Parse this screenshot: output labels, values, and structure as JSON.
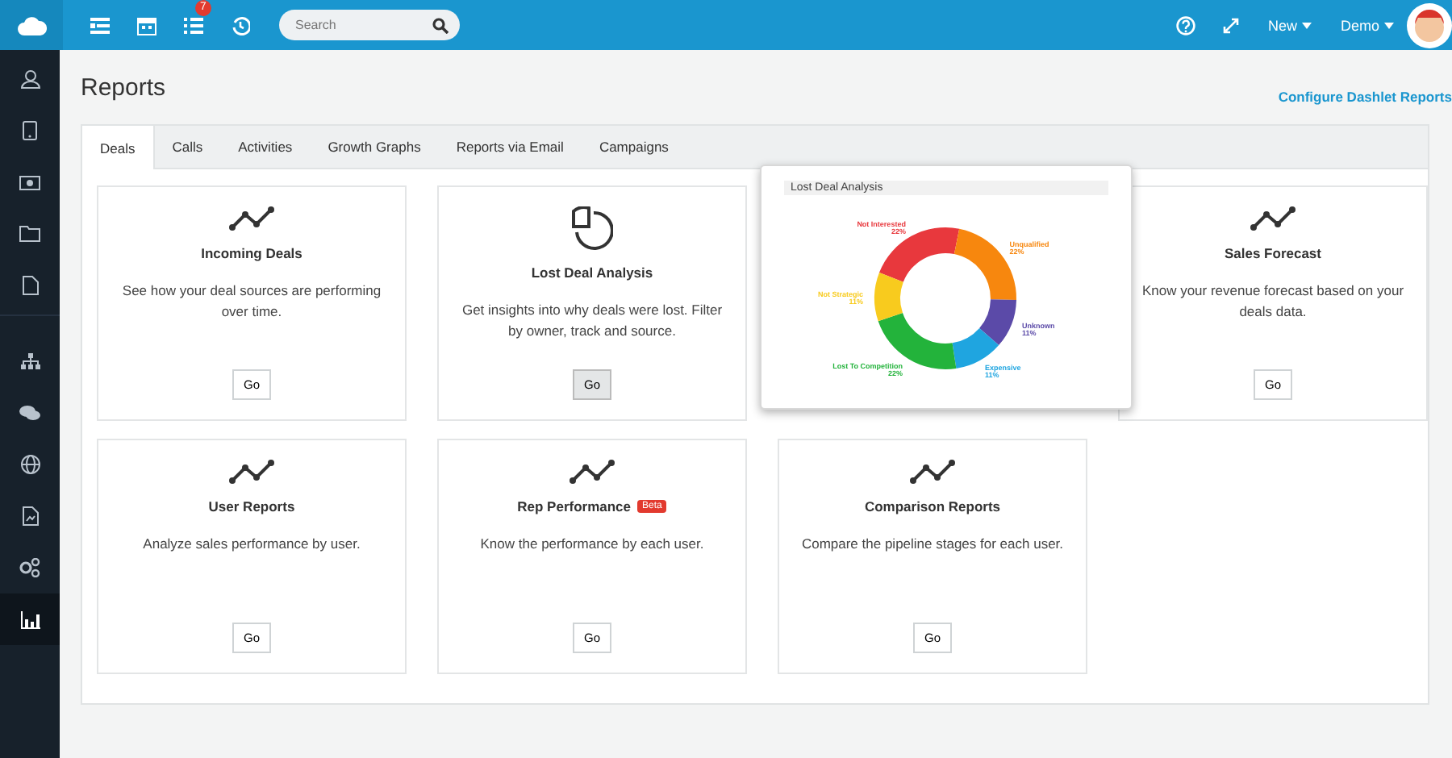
{
  "topbar": {
    "notification_count": "7",
    "search": {
      "placeholder": "Search"
    },
    "menus": [
      "New",
      "Demo"
    ]
  },
  "sidebar": {
    "items": [
      {
        "selected": false
      },
      {
        "selected": false
      },
      {
        "selected": false
      },
      {
        "selected": false
      },
      {
        "selected": false
      },
      {
        "selected": false
      },
      {
        "selected": false
      },
      {
        "selected": false
      },
      {
        "selected": false
      },
      {
        "selected": false
      },
      {
        "selected": true
      }
    ]
  },
  "page": {
    "title": "Reports",
    "link": "Configure Dashlet Reports"
  },
  "tabs": [
    {
      "label": "Deals",
      "selected": true
    },
    {
      "label": "Calls",
      "selected": false
    },
    {
      "label": "Activities",
      "selected": false
    },
    {
      "label": "Growth Graphs",
      "selected": false
    },
    {
      "label": "Reports via Email",
      "selected": false
    },
    {
      "label": "Campaigns",
      "selected": false
    }
  ],
  "cards": [
    {
      "kind": "line",
      "title": "Incoming Deals",
      "description": "See how your deal sources are performing over time.",
      "button": "Go"
    },
    {
      "kind": "pie",
      "title": "Lost Deal Analysis",
      "description": "Get insights into why deals were lost. Filter by owner, track and source.",
      "button": "Go"
    },
    {
      "kind": "line",
      "title": "Sales Forecast",
      "description": "Know your revenue forecast based on your deals data.",
      "button": "Go"
    },
    {
      "kind": "line",
      "title": "User Reports",
      "description": "Analyze sales performance by user.",
      "button": "Go"
    },
    {
      "kind": "line",
      "title": "Rep Performance",
      "badge": "Beta",
      "description": "Know the performance by each user.",
      "button": "Go"
    },
    {
      "kind": "line",
      "title": "Comparison Reports",
      "description": "Compare the pipeline stages for each user.",
      "button": "Go"
    }
  ],
  "preview": {
    "title": "Lost Deal Analysis",
    "chart_data": {
      "type": "donut",
      "categories": [
        "Not Interested",
        "Unqualified",
        "Unknown",
        "Expensive",
        "Lost To Competition",
        "Not Strategic"
      ],
      "series": [
        {
          "values": [
            22,
            22,
            11,
            11,
            22,
            11
          ]
        }
      ],
      "colors": [
        "#e8383d",
        "#f7870e",
        "#5b4aa8",
        "#1fa5e0",
        "#23b33b",
        "#f8cb1e"
      ],
      "value_labels": [
        "22%",
        "22%",
        "11%",
        "11%",
        "22%",
        "11%"
      ]
    }
  }
}
